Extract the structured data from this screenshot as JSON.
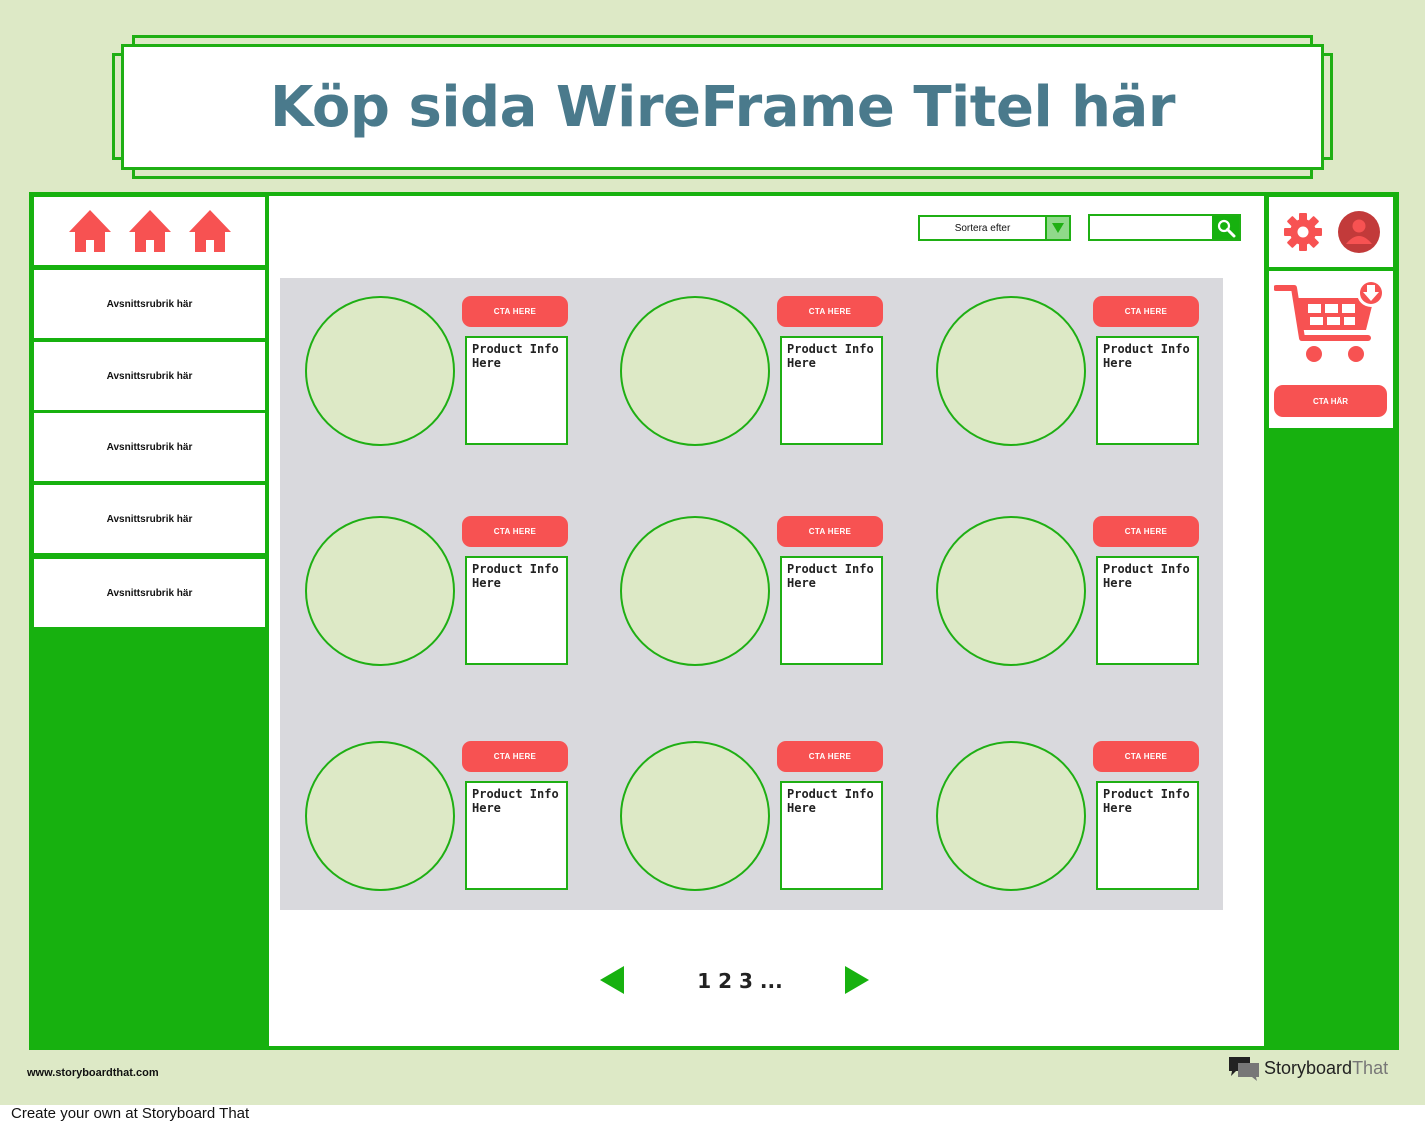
{
  "title": "Köp sida WireFrame Titel här",
  "sidebar": {
    "items": [
      {
        "label": "Avsnittsrubrik här"
      },
      {
        "label": "Avsnittsrubrik här"
      },
      {
        "label": "Avsnittsrubrik här"
      },
      {
        "label": "Avsnittsrubrik här"
      },
      {
        "label": "Avsnittsrubrik här"
      }
    ]
  },
  "toolbar": {
    "sort_label": "Sortera efter",
    "search_value": ""
  },
  "products": [
    {
      "cta": "CTA HERE",
      "info": "Product Info Here"
    },
    {
      "cta": "CTA HERE",
      "info": "Product Info Here"
    },
    {
      "cta": "CTA HERE",
      "info": "Product Info Here"
    },
    {
      "cta": "CTA HERE",
      "info": "Product Info Here"
    },
    {
      "cta": "CTA HERE",
      "info": "Product Info Here"
    },
    {
      "cta": "CTA HERE",
      "info": "Product Info Here"
    },
    {
      "cta": "CTA HERE",
      "info": "Product Info Here"
    },
    {
      "cta": "CTA HERE",
      "info": "Product Info Here"
    },
    {
      "cta": "CTA HERE",
      "info": "Product Info Here"
    }
  ],
  "pagination": {
    "pages": "1 2 3 ..."
  },
  "cart": {
    "cta": "CTA HÄR"
  },
  "footer": {
    "url": "www.storyboardthat.com",
    "brand_bold": "Storyboard",
    "brand_thin": "That",
    "create": "Create your own at Storyboard That"
  },
  "colors": {
    "background": "#dde9c6",
    "frame_green": "#17b10f",
    "accent_red": "#f75252",
    "title_blue": "#4a7a8c",
    "grid_gray": "#d9d9dd"
  },
  "icons": [
    "home-icon",
    "settings-gear-icon",
    "user-avatar-icon",
    "shopping-cart-icon",
    "search-icon",
    "chevron-down-icon",
    "arrow-left-icon",
    "arrow-right-icon"
  ]
}
